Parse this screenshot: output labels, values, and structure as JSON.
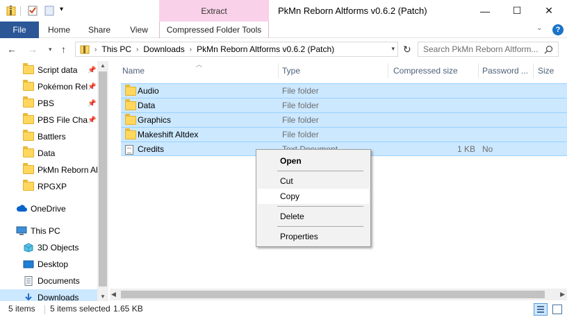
{
  "window": {
    "title": "PkMn Reborn Altforms v0.6.2 (Patch)",
    "context_tab_group": "Extract",
    "min_glyph": "—",
    "max_glyph": "☐",
    "close_glyph": "✕"
  },
  "ribbon": {
    "tabs": [
      "File",
      "Home",
      "Share",
      "View",
      "Compressed Folder Tools"
    ],
    "help_glyph": "?",
    "collapse_glyph": "⌄"
  },
  "address": {
    "path": [
      "This PC",
      "Downloads",
      "PkMn Reborn Altforms v0.6.2 (Patch)"
    ],
    "separator": "›",
    "search_placeholder": "Search PkMn Reborn Altform..."
  },
  "navpane": {
    "items": [
      {
        "label": "Script data",
        "pinned": true
      },
      {
        "label": "Pokémon Rel",
        "pinned": true
      },
      {
        "label": "PBS",
        "pinned": true
      },
      {
        "label": "PBS File Char",
        "pinned": true
      },
      {
        "label": "Battlers",
        "pinned": false
      },
      {
        "label": "Data",
        "pinned": false
      },
      {
        "label": "PkMn Reborn Al",
        "pinned": false
      },
      {
        "label": "RPGXP",
        "pinned": false
      },
      {
        "label": "OneDrive",
        "pinned": false
      },
      {
        "label": "This PC",
        "pinned": false
      },
      {
        "label": "3D Objects",
        "pinned": false
      },
      {
        "label": "Desktop",
        "pinned": false
      },
      {
        "label": "Documents",
        "pinned": false
      },
      {
        "label": "Downloads",
        "pinned": false
      }
    ],
    "pin_glyph": "📌"
  },
  "columns": {
    "name": "Name",
    "type": "Type",
    "compressed_size": "Compressed size",
    "password": "Password ...",
    "size": "Size"
  },
  "files": [
    {
      "name": "Audio",
      "type": "File folder",
      "compressed_size": "",
      "password": "",
      "icon": "folder-icon"
    },
    {
      "name": "Data",
      "type": "File folder",
      "compressed_size": "",
      "password": "",
      "icon": "folder-icon"
    },
    {
      "name": "Graphics",
      "type": "File folder",
      "compressed_size": "",
      "password": "",
      "icon": "folder-icon"
    },
    {
      "name": "Makeshift Altdex",
      "type": "File folder",
      "compressed_size": "",
      "password": "",
      "icon": "folder-icon"
    },
    {
      "name": "Credits",
      "type": "Text Document",
      "compressed_size": "1 KB",
      "password": "No",
      "icon": "text-document-icon"
    }
  ],
  "context_menu": {
    "open": "Open",
    "cut": "Cut",
    "copy": "Copy",
    "delete": "Delete",
    "properties": "Properties"
  },
  "status": {
    "item_count": "5 items",
    "selected": "5 items selected",
    "size": "1.65 KB"
  },
  "colors": {
    "file_tab": "#2b5797",
    "context_tab": "#f9d1e8",
    "selection": "#cce8ff",
    "selection_border": "#99d1ff"
  }
}
